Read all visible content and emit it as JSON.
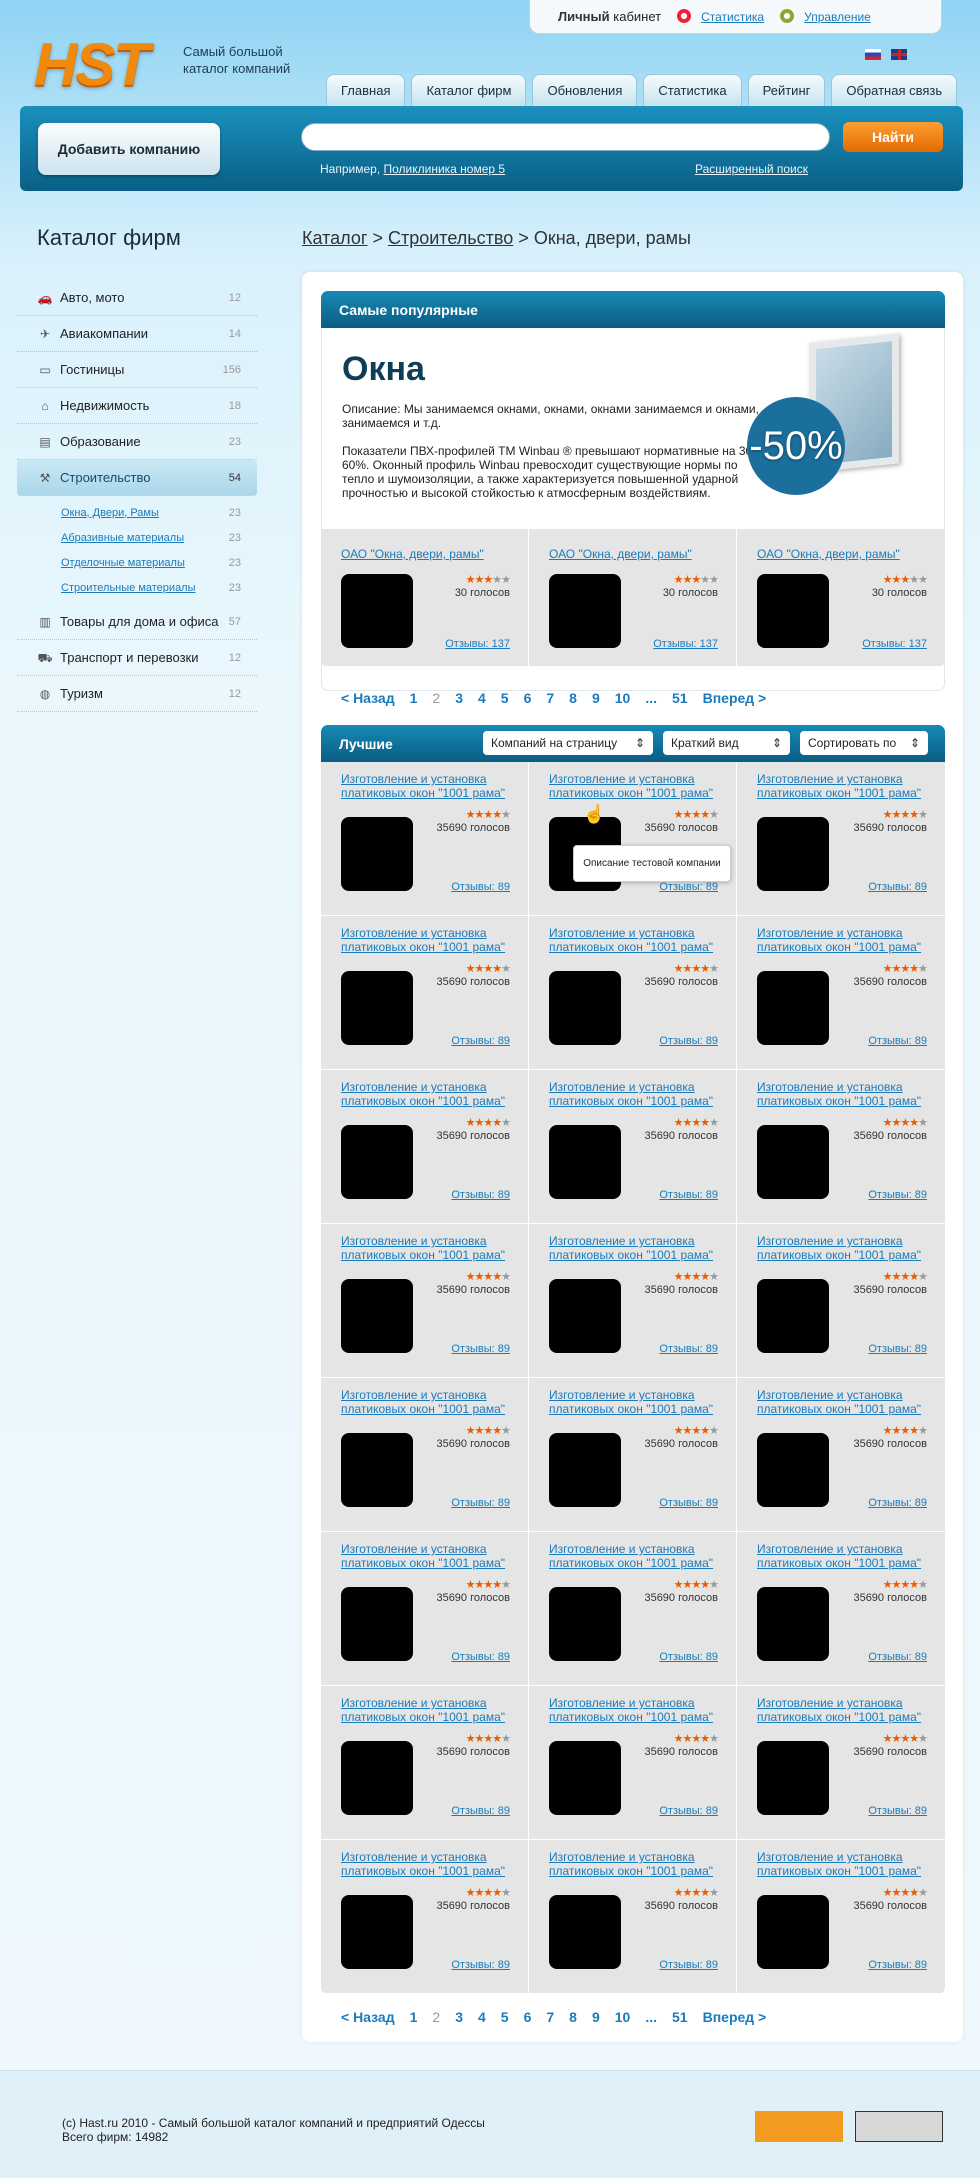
{
  "logo": "HST",
  "tagline": "Самый большой каталог компаний",
  "cabinet": {
    "label_bold": "Личный",
    "label": "кабинет",
    "stats": "Статистика",
    "manage": "Управление"
  },
  "nav": [
    "Главная",
    "Каталог фирм",
    "Обновления",
    "Статистика",
    "Рейтинг",
    "Обратная связь"
  ],
  "search": {
    "add_company": "Добавить компанию",
    "placeholder": "",
    "button": "Найти",
    "example_prefix": "Например,",
    "example_link": "Поликлиника номер 5",
    "advanced": "Расширенный поиск"
  },
  "sidebar": {
    "title": "Каталог фирм",
    "items": [
      {
        "label": "Авто, мото",
        "count": "12",
        "icon": "car-icon"
      },
      {
        "label": "Авиакомпании",
        "count": "14",
        "icon": "plane-icon"
      },
      {
        "label": "Гостиницы",
        "count": "156",
        "icon": "bed-icon"
      },
      {
        "label": "Недвижимость",
        "count": "18",
        "icon": "house-icon"
      },
      {
        "label": "Образование",
        "count": "23",
        "icon": "book-icon"
      },
      {
        "label": "Строительство",
        "count": "54",
        "icon": "crane-icon"
      },
      {
        "label": "Товары для дома и офиса",
        "count": "57",
        "icon": "basket-icon"
      },
      {
        "label": "Транспорт и перевозки",
        "count": "12",
        "icon": "truck-icon"
      },
      {
        "label": "Туризм",
        "count": "12",
        "icon": "globe-icon"
      }
    ],
    "subitems": [
      {
        "label": "Окна, Двери, Рамы",
        "count": "23"
      },
      {
        "label": "Абразивные материалы",
        "count": "23"
      },
      {
        "label": "Отделочные материалы",
        "count": "23"
      },
      {
        "label": "Строительные материалы",
        "count": "23"
      }
    ]
  },
  "breadcrumb": {
    "a": "Каталог",
    "b": "Строительство",
    "c": "Окна, двери, рамы",
    "sep": ">"
  },
  "popular": {
    "header": "Самые популярные",
    "title": "Окна",
    "desc1": "Описание: Мы занимаемся окнами, окнами, окнами занимаемся и окнами, занимаемся и т.д.",
    "desc2": "Показатели ПВХ-профилей ТМ Winbau ® превышают нормативные на 30-60%. Оконный профиль Winbau превосходит существующие нормы по тепло и шумоизоляции, а также характеризуется повышенной ударной прочностью и высокой стойкостью к атмосферным воздействиям.",
    "promo": "-50%",
    "cards": [
      {
        "name": "ОАО \"Окна, двери, рамы\"",
        "votes": "30 голосов",
        "reviews": "Отзывы: 137",
        "rating": 3
      },
      {
        "name": "ОАО \"Окна, двери, рамы\"",
        "votes": "30 голосов",
        "reviews": "Отзывы: 137",
        "rating": 3
      },
      {
        "name": "ОАО \"Окна, двери, рамы\"",
        "votes": "30 голосов",
        "reviews": "Отзывы: 137",
        "rating": 3
      }
    ]
  },
  "pager": {
    "prev": "< Назад",
    "pages": [
      "1",
      "2",
      "3",
      "4",
      "5",
      "6",
      "7",
      "8",
      "9",
      "10",
      "...",
      "51"
    ],
    "current": "2",
    "next": "Вперед >"
  },
  "best": {
    "header": "Лучшие",
    "per_page": "Компаний на страницу",
    "view": "Краткий вид",
    "sort": "Сортировать по",
    "card": {
      "name": "Изготовление и установка платиковых окон \"1001 рама\"",
      "votes": "35690 голосов",
      "reviews": "Отзывы: 89",
      "rating": 4
    },
    "count": 24,
    "tooltip": "Описание тестовой компании"
  },
  "footer": {
    "line1": "(c) Hast.ru 2010  -  Самый большой каталог компаний и предприятий Одессы",
    "line2": "Всего фирм: 14982"
  }
}
